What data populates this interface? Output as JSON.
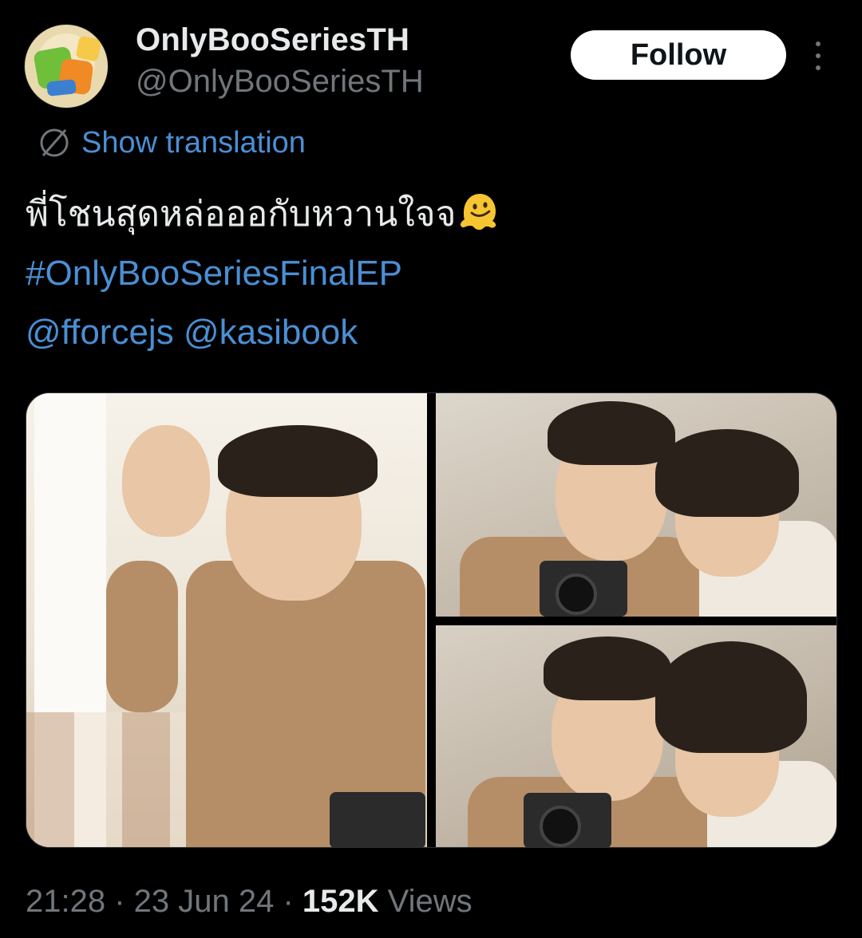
{
  "author": {
    "display_name": "OnlyBooSeriesTH",
    "handle": "@OnlyBooSeriesTH",
    "avatar_icon": "series-logo-avatar"
  },
  "actions": {
    "follow_label": "Follow",
    "more_icon": "more-vertical-icon"
  },
  "translation": {
    "icon": "globe-icon",
    "label": "Show translation"
  },
  "tweet": {
    "text_line": "พี่โชนสุดหล่อออกับหวานใจจ",
    "emoji": "melting-face-emoji",
    "hashtag": "#OnlyBooSeriesFinalEP",
    "mention_1": "@fforcejs",
    "mention_2": "@kasibook"
  },
  "media": {
    "count": 3,
    "items": [
      {
        "name": "photo-ok-gesture"
      },
      {
        "name": "photo-camera-look-1"
      },
      {
        "name": "photo-camera-look-2"
      }
    ]
  },
  "meta": {
    "time": "21:28",
    "sep1": " · ",
    "date": "23 Jun 24",
    "sep2": " · ",
    "views_count": "152K",
    "views_label": " Views"
  },
  "colors": {
    "background": "#000000",
    "link": "#4a8fd4",
    "secondary_text": "#71767b",
    "primary_text": "#e7e9ea"
  }
}
